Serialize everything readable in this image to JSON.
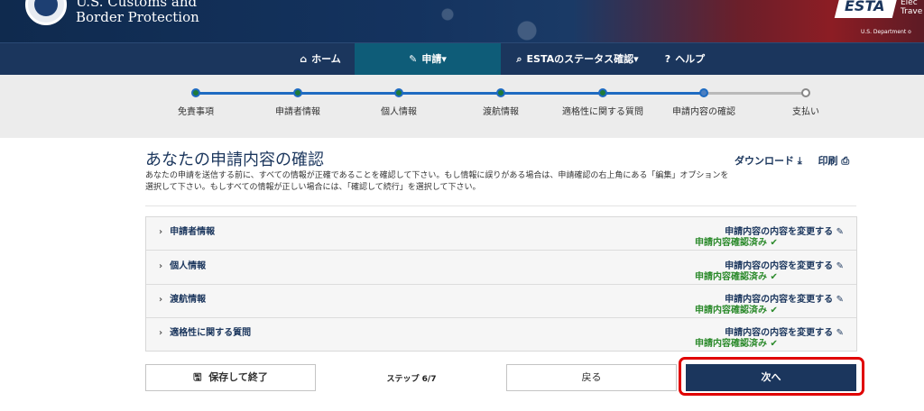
{
  "header": {
    "agency_line1": "U.S. Customs and",
    "agency_line2": "Border Protection",
    "esta_logo": "ESTA",
    "esta_side_line1": "Elec",
    "esta_side_line2": "Trave",
    "esta_dept": "U.S. Department o"
  },
  "nav": {
    "home": "ホーム",
    "apply": "申請",
    "status": "ESTAのステータス確認",
    "help": "ヘルプ"
  },
  "progress": {
    "steps": [
      "免責事項",
      "申請者情報",
      "個人情報",
      "渡航情報",
      "適格性に関する質問",
      "申請内容の確認",
      "支払い"
    ]
  },
  "main": {
    "title": "あなたの申請内容の確認",
    "desc_line1": "あなたの申請を送信する前に、すべての情報が正確であることを確認して下さい。もし情報に誤りがある場合は、申請確認の右上角にある「編集」オプションを",
    "desc_line2": "選択して下さい。もしすべての情報が正しい場合には、「確認して続行」を選択して下さい。",
    "download": "ダウンロード",
    "print": "印刷"
  },
  "sections": [
    {
      "title": "申請者情報",
      "edit": "申請内容の内容を変更する",
      "status": "申請内容確認済み"
    },
    {
      "title": "個人情報",
      "edit": "申請内容の内容を変更する",
      "status": "申請内容確認済み"
    },
    {
      "title": "渡航情報",
      "edit": "申請内容の内容を変更する",
      "status": "申請内容確認済み"
    },
    {
      "title": "適格性に関する質問",
      "edit": "申請内容の内容を変更する",
      "status": "申請内容確認済み"
    }
  ],
  "footer": {
    "save": "保存して終了",
    "step": "ステップ 6/7",
    "back": "戻る",
    "next": "次へ"
  },
  "icons": {
    "home": "home-icon",
    "pencil": "pencil-icon",
    "search": "search-icon",
    "help": "help-circle-icon",
    "download": "download-icon",
    "print": "printer-icon",
    "chevron": "chevron-right-icon",
    "check": "check-icon",
    "save": "floppy-disk-icon"
  },
  "colors": {
    "nav": "#1b365d",
    "nav_active": "#0e5c78",
    "progress_done": "#1e6bc1",
    "verified": "#2b8a2b",
    "highlight": "#e00000"
  }
}
